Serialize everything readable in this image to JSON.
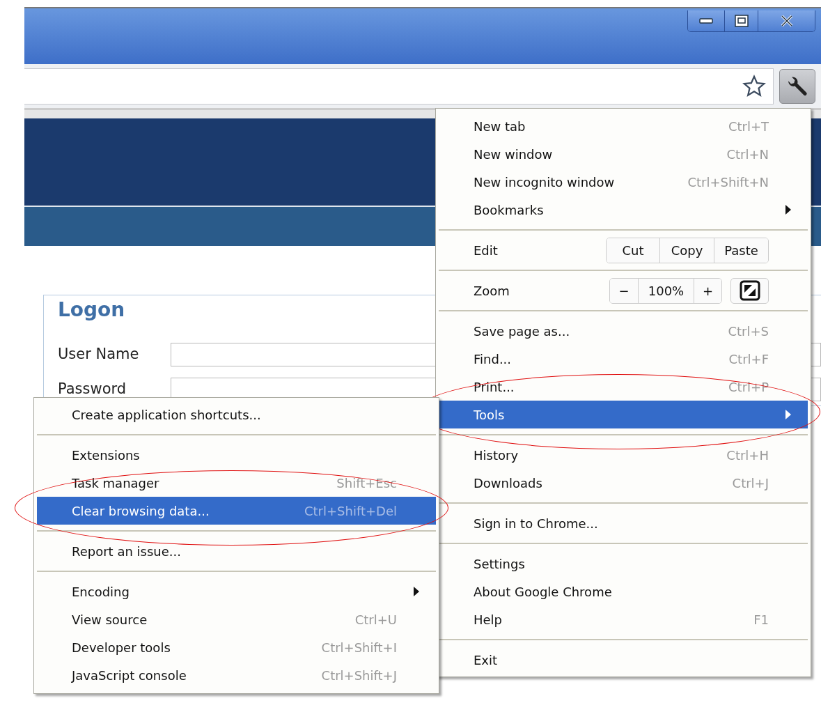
{
  "page": {
    "logon_title": "Logon",
    "fields": [
      {
        "label": "User Name"
      },
      {
        "label": "Password"
      }
    ]
  },
  "menu": {
    "items": [
      {
        "kind": "item",
        "label": "New tab",
        "shortcut": "Ctrl+T",
        "has_submenu": false,
        "selected": false,
        "circled": false
      },
      {
        "kind": "item",
        "label": "New window",
        "shortcut": "Ctrl+N",
        "has_submenu": false,
        "selected": false,
        "circled": false
      },
      {
        "kind": "item",
        "label": "New incognito window",
        "shortcut": "Ctrl+Shift+N",
        "has_submenu": false,
        "selected": false,
        "circled": false
      },
      {
        "kind": "item",
        "label": "Bookmarks",
        "has_submenu": true,
        "selected": false,
        "circled": false
      },
      {
        "kind": "separator"
      },
      {
        "kind": "edit",
        "label": "Edit",
        "buttons": [
          "Cut",
          "Copy",
          "Paste"
        ]
      },
      {
        "kind": "separator"
      },
      {
        "kind": "zoom",
        "label": "Zoom",
        "decrease": "−",
        "value": "100%",
        "increase": "+"
      },
      {
        "kind": "separator"
      },
      {
        "kind": "item",
        "label": "Save page as...",
        "shortcut": "Ctrl+S",
        "has_submenu": false,
        "selected": false,
        "circled": false
      },
      {
        "kind": "item",
        "label": "Find...",
        "shortcut": "Ctrl+F",
        "has_submenu": false,
        "selected": false,
        "circled": false
      },
      {
        "kind": "item",
        "label": "Print...",
        "shortcut": "Ctrl+P",
        "has_submenu": false,
        "selected": false,
        "circled": false
      },
      {
        "kind": "item",
        "label": "Tools",
        "has_submenu": true,
        "selected": true,
        "circled": true
      },
      {
        "kind": "separator"
      },
      {
        "kind": "item",
        "label": "History",
        "shortcut": "Ctrl+H",
        "has_submenu": false,
        "selected": false,
        "circled": false
      },
      {
        "kind": "item",
        "label": "Downloads",
        "shortcut": "Ctrl+J",
        "has_submenu": false,
        "selected": false,
        "circled": false
      },
      {
        "kind": "separator"
      },
      {
        "kind": "item",
        "label": "Sign in to Chrome...",
        "has_submenu": false,
        "selected": false,
        "circled": false
      },
      {
        "kind": "separator"
      },
      {
        "kind": "item",
        "label": "Settings",
        "has_submenu": false,
        "selected": false,
        "circled": false
      },
      {
        "kind": "item",
        "label": "About Google Chrome",
        "has_submenu": false,
        "selected": false,
        "circled": false
      },
      {
        "kind": "item",
        "label": "Help",
        "shortcut": "F1",
        "has_submenu": false,
        "selected": false,
        "circled": false
      },
      {
        "kind": "separator"
      },
      {
        "kind": "item",
        "label": "Exit",
        "has_submenu": false,
        "selected": false,
        "circled": false
      }
    ]
  },
  "submenu": {
    "items": [
      {
        "kind": "item",
        "label": "Create application shortcuts...",
        "has_submenu": false,
        "selected": false,
        "circled": false
      },
      {
        "kind": "separator"
      },
      {
        "kind": "item",
        "label": "Extensions",
        "has_submenu": false,
        "selected": false,
        "circled": false
      },
      {
        "kind": "item",
        "label": "Task manager",
        "shortcut": "Shift+Esc",
        "has_submenu": false,
        "selected": false,
        "circled": false
      },
      {
        "kind": "item",
        "label": "Clear browsing data...",
        "shortcut": "Ctrl+Shift+Del",
        "has_submenu": false,
        "selected": true,
        "circled": true
      },
      {
        "kind": "separator"
      },
      {
        "kind": "item",
        "label": "Report an issue...",
        "has_submenu": false,
        "selected": false,
        "circled": false
      },
      {
        "kind": "separator"
      },
      {
        "kind": "item",
        "label": "Encoding",
        "has_submenu": true,
        "selected": false,
        "circled": false
      },
      {
        "kind": "item",
        "label": "View source",
        "shortcut": "Ctrl+U",
        "has_submenu": false,
        "selected": false,
        "circled": false
      },
      {
        "kind": "item",
        "label": "Developer tools",
        "shortcut": "Ctrl+Shift+I",
        "has_submenu": false,
        "selected": false,
        "circled": false
      },
      {
        "kind": "item",
        "label": "JavaScript console",
        "shortcut": "Ctrl+Shift+J",
        "has_submenu": false,
        "selected": false,
        "circled": false
      }
    ]
  }
}
